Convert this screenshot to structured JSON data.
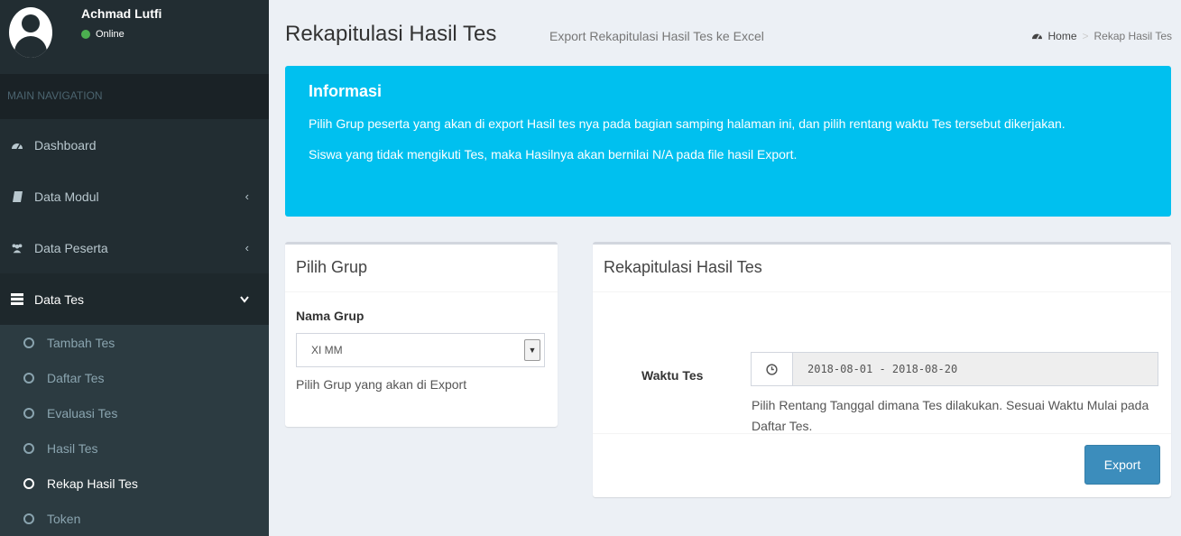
{
  "user": {
    "name": "Achmad Lutfi",
    "status": "Online"
  },
  "sidebar": {
    "header": "MAIN NAVIGATION",
    "items": [
      {
        "label": "Dashboard",
        "icon": "dashboard-icon"
      },
      {
        "label": "Data Modul",
        "icon": "book-icon"
      },
      {
        "label": "Data Peserta",
        "icon": "users-icon"
      },
      {
        "label": "Data Tes",
        "icon": "tasks-icon"
      }
    ],
    "submenu": [
      "Tambah Tes",
      "Daftar Tes",
      "Evaluasi Tes",
      "Hasil Tes",
      "Rekap Hasil Tes",
      "Token"
    ]
  },
  "page": {
    "title": "Rekapitulasi Hasil Tes",
    "subtitle": "Export Rekapitulasi Hasil Tes ke Excel"
  },
  "breadcrumb": {
    "home": "Home",
    "current": "Rekap Hasil Tes"
  },
  "info": {
    "title": "Informasi",
    "line1": "Pilih Grup peserta yang akan di export Hasil tes nya pada bagian samping halaman ini, dan pilih rentang waktu Tes tersebut dikerjakan.",
    "line2": "Siswa yang tidak mengikuti Tes, maka Hasilnya akan bernilai N/A pada file hasil Export."
  },
  "group": {
    "title": "Pilih Grup",
    "label": "Nama Grup",
    "selected": "XI MM",
    "help": "Pilih Grup yang akan di Export"
  },
  "rekap": {
    "title": "Rekapitulasi Hasil Tes",
    "label": "Waktu Tes",
    "range": "2018-08-01 - 2018-08-20",
    "help": "Pilih Rentang Tanggal dimana Tes dilakukan. Sesuai Waktu Mulai pada Daftar Tes.",
    "export_label": "Export"
  },
  "colors": {
    "sidebar_bg": "#222d32",
    "info_bg": "#00c0ef",
    "primary": "#3c8dbc",
    "status_online": "#4caf50"
  }
}
